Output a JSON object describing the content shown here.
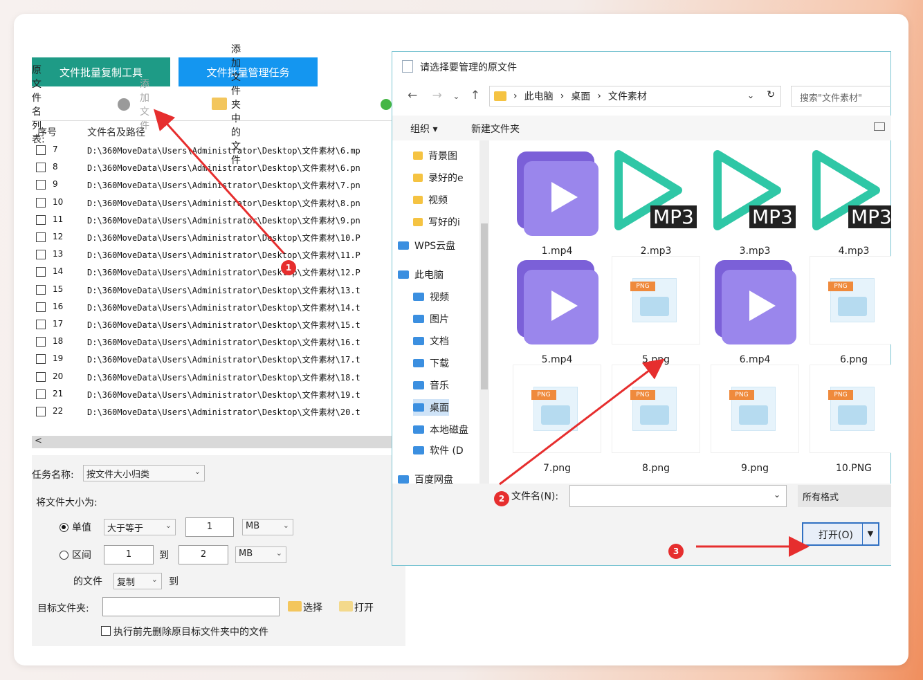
{
  "app": {
    "tab_copy": "文件批量复制工具",
    "tab_manage": "文件批量管理任务",
    "file_list_label": "原文件名列表:",
    "add_file": "添加文件",
    "add_folder_files": "添加文件夹中的文件",
    "col_index": "序号",
    "col_path": "文件名及路径",
    "rows": [
      {
        "n": "7",
        "path": "D:\\360MoveData\\Users\\Administrator\\Desktop\\文件素材\\6.mp"
      },
      {
        "n": "8",
        "path": "D:\\360MoveData\\Users\\Administrator\\Desktop\\文件素材\\6.pn"
      },
      {
        "n": "9",
        "path": "D:\\360MoveData\\Users\\Administrator\\Desktop\\文件素材\\7.pn"
      },
      {
        "n": "10",
        "path": "D:\\360MoveData\\Users\\Administrator\\Desktop\\文件素材\\8.pn"
      },
      {
        "n": "11",
        "path": "D:\\360MoveData\\Users\\Administrator\\Desktop\\文件素材\\9.pn"
      },
      {
        "n": "12",
        "path": "D:\\360MoveData\\Users\\Administrator\\Desktop\\文件素材\\10.P"
      },
      {
        "n": "13",
        "path": "D:\\360MoveData\\Users\\Administrator\\Desktop\\文件素材\\11.P"
      },
      {
        "n": "14",
        "path": "D:\\360MoveData\\Users\\Administrator\\Desktop\\文件素材\\12.P"
      },
      {
        "n": "15",
        "path": "D:\\360MoveData\\Users\\Administrator\\Desktop\\文件素材\\13.t"
      },
      {
        "n": "16",
        "path": "D:\\360MoveData\\Users\\Administrator\\Desktop\\文件素材\\14.t"
      },
      {
        "n": "17",
        "path": "D:\\360MoveData\\Users\\Administrator\\Desktop\\文件素材\\15.t"
      },
      {
        "n": "18",
        "path": "D:\\360MoveData\\Users\\Administrator\\Desktop\\文件素材\\16.t"
      },
      {
        "n": "19",
        "path": "D:\\360MoveData\\Users\\Administrator\\Desktop\\文件素材\\17.t"
      },
      {
        "n": "20",
        "path": "D:\\360MoveData\\Users\\Administrator\\Desktop\\文件素材\\18.t"
      },
      {
        "n": "21",
        "path": "D:\\360MoveData\\Users\\Administrator\\Desktop\\文件素材\\19.t"
      },
      {
        "n": "22",
        "path": "D:\\360MoveData\\Users\\Administrator\\Desktop\\文件素材\\20.t"
      }
    ],
    "task_name_label": "任务名称:",
    "task_name_value": "按文件大小归类",
    "size_label": "将文件大小为:",
    "single_label": "单值",
    "single_op": "大于等于",
    "single_value": "1",
    "single_unit": "MB",
    "range_label": "区间",
    "range_from": "1",
    "range_to_label": "到",
    "range_to": "2",
    "range_unit": "MB",
    "file_of_label": "的文件",
    "action_value": "复制",
    "action_to_label": "到",
    "target_folder_label": "目标文件夹:",
    "target_folder_value": "",
    "choose_label": "选择",
    "open_label": "打开",
    "delete_before_label": "执行前先删除原目标文件夹中的文件"
  },
  "dialog": {
    "title": "请选择要管理的原文件",
    "path": [
      "此电脑",
      "桌面",
      "文件素材"
    ],
    "search_placeholder": "搜索\"文件素材\"",
    "organize": "组织 ▾",
    "new_folder": "新建文件夹",
    "nav_items": [
      "背景图",
      "录好的e",
      "视频",
      "写好的i",
      "WPS云盘",
      "此电脑",
      "视频",
      "图片",
      "文档",
      "下载",
      "音乐",
      "桌面",
      "本地磁盘",
      "软件 (D",
      "百度网盘"
    ],
    "files": [
      {
        "name": "1.mp4",
        "type": "video"
      },
      {
        "name": "2.mp3",
        "type": "audio"
      },
      {
        "name": "3.mp3",
        "type": "audio"
      },
      {
        "name": "4.mp3",
        "type": "audio"
      },
      {
        "name": "5.mp4",
        "type": "video"
      },
      {
        "name": "5.png",
        "type": "png"
      },
      {
        "name": "6.mp4",
        "type": "video"
      },
      {
        "name": "6.png",
        "type": "png"
      },
      {
        "name": "7.png",
        "type": "png"
      },
      {
        "name": "8.png",
        "type": "png"
      },
      {
        "name": "9.png",
        "type": "png"
      },
      {
        "name": "10.PNG",
        "type": "png"
      }
    ],
    "mp3_badge": "MP3",
    "png_badge": "PNG",
    "filename_label": "文件名(N):",
    "filename_value": "",
    "filter_value": "所有格式",
    "open_button": "打开(O)"
  },
  "annotations": {
    "badge1": "1",
    "badge2": "2",
    "badge3": "3"
  },
  "colors": {
    "tab_copy": "#1e9b86",
    "tab_manage": "#1496f0",
    "arrow": "#e62e2e",
    "video": "#9a86ec",
    "audio": "#2fc7a6"
  }
}
